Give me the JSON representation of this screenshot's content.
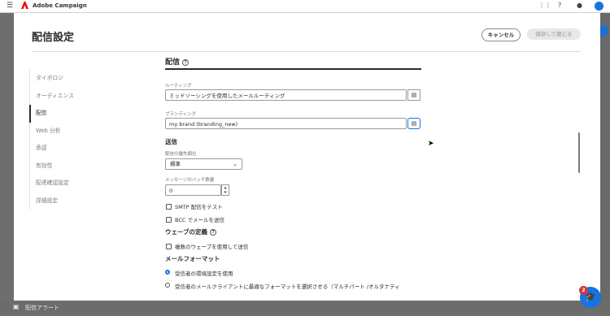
{
  "app": {
    "title": "Adobe Campaign"
  },
  "background": {
    "bottom_item": "配信アラート"
  },
  "modal": {
    "title": "配信設定",
    "cancel_label": "キャンセル",
    "save_label": "保存して閉じる"
  },
  "nav": {
    "items": [
      {
        "label": "タイポロジ"
      },
      {
        "label": "オーディエンス"
      },
      {
        "label": "配信"
      },
      {
        "label": "Web 分析"
      },
      {
        "label": "承認"
      },
      {
        "label": "有効性"
      },
      {
        "label": "配達確認設定"
      },
      {
        "label": "詳細設定"
      }
    ],
    "active_index": 2
  },
  "content": {
    "section_title": "配信",
    "routing": {
      "label": "ルーティング",
      "value": "ミッドソーシングを使用したメールルーティング"
    },
    "branding": {
      "label": "ブランディング",
      "value": "my brand (branding_new)"
    },
    "send": {
      "title": "送信",
      "priority_label": "配信の優先順位",
      "priority_value": "標準",
      "batch_label": "メッセージのバッチ数量",
      "batch_value": "0",
      "smtp_test": "SMTP 配信をテスト",
      "bcc": "BCC でメールを送信"
    },
    "wave": {
      "title": "ウェーブの定義",
      "multi_wave": "複数のウェーブを使用して送信"
    },
    "mail_format": {
      "title": "メールフォーマット",
      "option_recipient": "受信者の環境設定を使用",
      "option_client": "受信者のメールクライアントに最適なフォーマットを選択させる（マルチパート /オルタナティ"
    }
  },
  "help": {
    "badge_count": "2"
  },
  "icons": [
    "menu-icon",
    "adobe-logo-icon",
    "apps-grid-icon",
    "help-icon",
    "bell-icon",
    "folder-picker-icon",
    "chevron-down-icon",
    "graduation-cap-icon",
    "cursor-icon"
  ],
  "colors": {
    "accent": "#1473e6",
    "badge": "#d7373f"
  }
}
